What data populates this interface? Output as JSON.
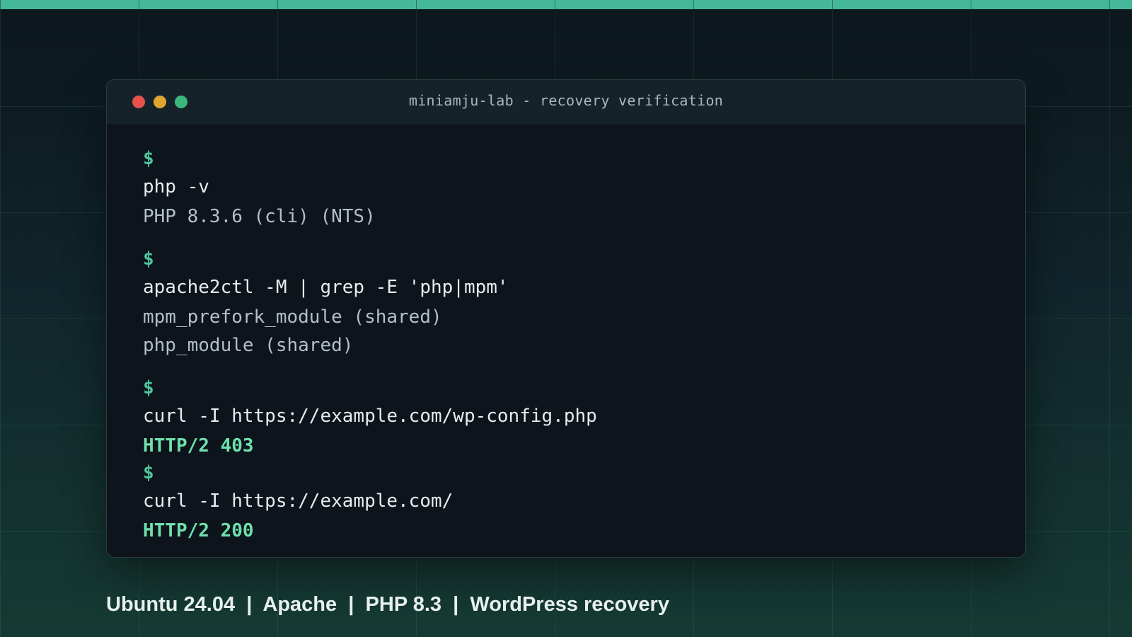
{
  "window": {
    "title": "miniamju-lab - recovery verification"
  },
  "terminal": {
    "prompt": "$",
    "blocks": [
      {
        "command": "php -v",
        "output": [
          "PHP 8.3.6 (cli) (NTS)"
        ]
      },
      {
        "command": "apache2ctl -M | grep -E 'php|mpm'",
        "output": [
          "mpm_prefork_module (shared)",
          "php_module (shared)"
        ]
      },
      {
        "command": "curl -I https://example.com/wp-config.php",
        "output": [
          "HTTP/2 403"
        ]
      },
      {
        "command": "curl -I https://example.com/",
        "output": [
          "HTTP/2 200"
        ]
      }
    ]
  },
  "footer": {
    "items": [
      "Ubuntu 24.04",
      "Apache",
      "PHP 8.3",
      "WordPress recovery"
    ],
    "separator": "|"
  },
  "colors": {
    "accent": "#46b89a",
    "prompt": "#4fc79e",
    "status_ok": "#6fe0ad",
    "close_dot": "#e5534b",
    "minimize_dot": "#e0a530",
    "maximize_dot": "#3bb77e"
  }
}
